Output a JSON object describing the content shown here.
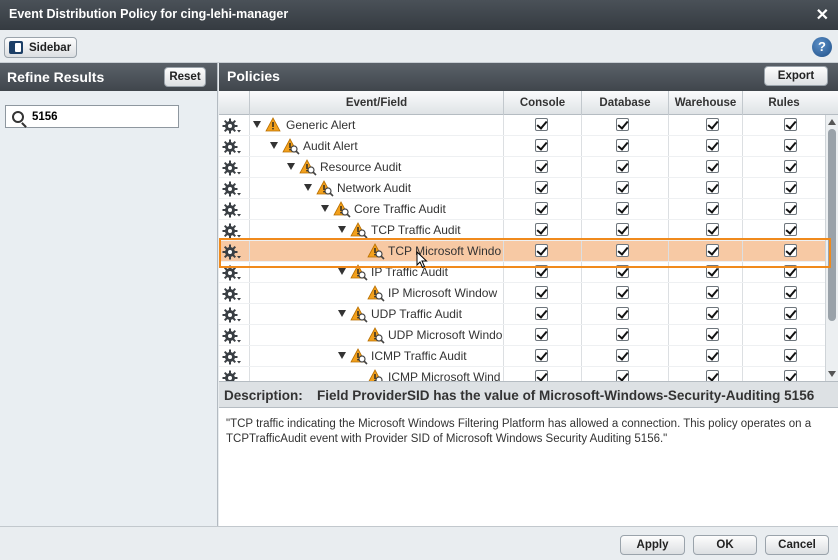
{
  "window": {
    "title": "Event Distribution Policy for cing-lehi-manager",
    "close_label": "✕"
  },
  "toolbar": {
    "sidebar_label": "Sidebar",
    "help_label": "?"
  },
  "refine": {
    "title": "Refine Results",
    "reset_label": "Reset",
    "search_value": "5156"
  },
  "policies": {
    "title": "Policies",
    "export_label": "Export",
    "columns": [
      "Event/Field",
      "Console",
      "Database",
      "Warehouse",
      "Rules"
    ],
    "rows": [
      {
        "label": "Generic Alert",
        "level": 0,
        "expanded": true,
        "selected": false,
        "checks": [
          true,
          true,
          true,
          true
        ]
      },
      {
        "label": "Audit Alert",
        "level": 1,
        "expanded": true,
        "selected": false,
        "checks": [
          true,
          true,
          true,
          true
        ]
      },
      {
        "label": "Resource Audit",
        "level": 2,
        "expanded": true,
        "selected": false,
        "checks": [
          true,
          true,
          true,
          true
        ]
      },
      {
        "label": "Network Audit",
        "level": 3,
        "expanded": true,
        "selected": false,
        "checks": [
          true,
          true,
          true,
          true
        ]
      },
      {
        "label": "Core Traffic Audit",
        "level": 4,
        "expanded": true,
        "selected": false,
        "checks": [
          true,
          true,
          true,
          true
        ]
      },
      {
        "label": "TCP Traffic Audit",
        "level": 5,
        "expanded": true,
        "selected": false,
        "checks": [
          true,
          true,
          true,
          true
        ]
      },
      {
        "label": "TCP Microsoft Windo",
        "level": 6,
        "expanded": false,
        "selected": true,
        "checks": [
          true,
          true,
          true,
          true
        ]
      },
      {
        "label": "IP Traffic Audit",
        "level": 5,
        "expanded": true,
        "selected": false,
        "checks": [
          true,
          true,
          true,
          true
        ]
      },
      {
        "label": "IP Microsoft Window",
        "level": 6,
        "expanded": false,
        "selected": false,
        "checks": [
          true,
          true,
          true,
          true
        ]
      },
      {
        "label": "UDP Traffic Audit",
        "level": 5,
        "expanded": true,
        "selected": false,
        "checks": [
          true,
          true,
          true,
          true
        ]
      },
      {
        "label": "UDP Microsoft Windo",
        "level": 6,
        "expanded": false,
        "selected": false,
        "checks": [
          true,
          true,
          true,
          true
        ]
      },
      {
        "label": "ICMP Traffic Audit",
        "level": 5,
        "expanded": true,
        "selected": false,
        "checks": [
          true,
          true,
          true,
          true
        ]
      },
      {
        "label": "ICMP Microsoft Wind",
        "level": 6,
        "expanded": false,
        "selected": false,
        "checks": [
          true,
          true,
          true,
          true
        ]
      }
    ]
  },
  "description": {
    "label": "Description:",
    "field": "Field ProviderSID has the value of Microsoft-Windows-Security-Auditing 5156",
    "text": "\"TCP traffic indicating the Microsoft Windows Filtering Platform has allowed a connection. This policy operates on a TCPTrafficAudit event with Provider SID of Microsoft Windows Security Auditing 5156.\""
  },
  "footer": {
    "apply_label": "Apply",
    "ok_label": "OK",
    "cancel_label": "Cancel"
  },
  "colors": {
    "selection_fill": "#f7c9a4",
    "selection_border": "#f08a1c",
    "header_dark": "#40464c",
    "warning": "#f2a01c"
  }
}
